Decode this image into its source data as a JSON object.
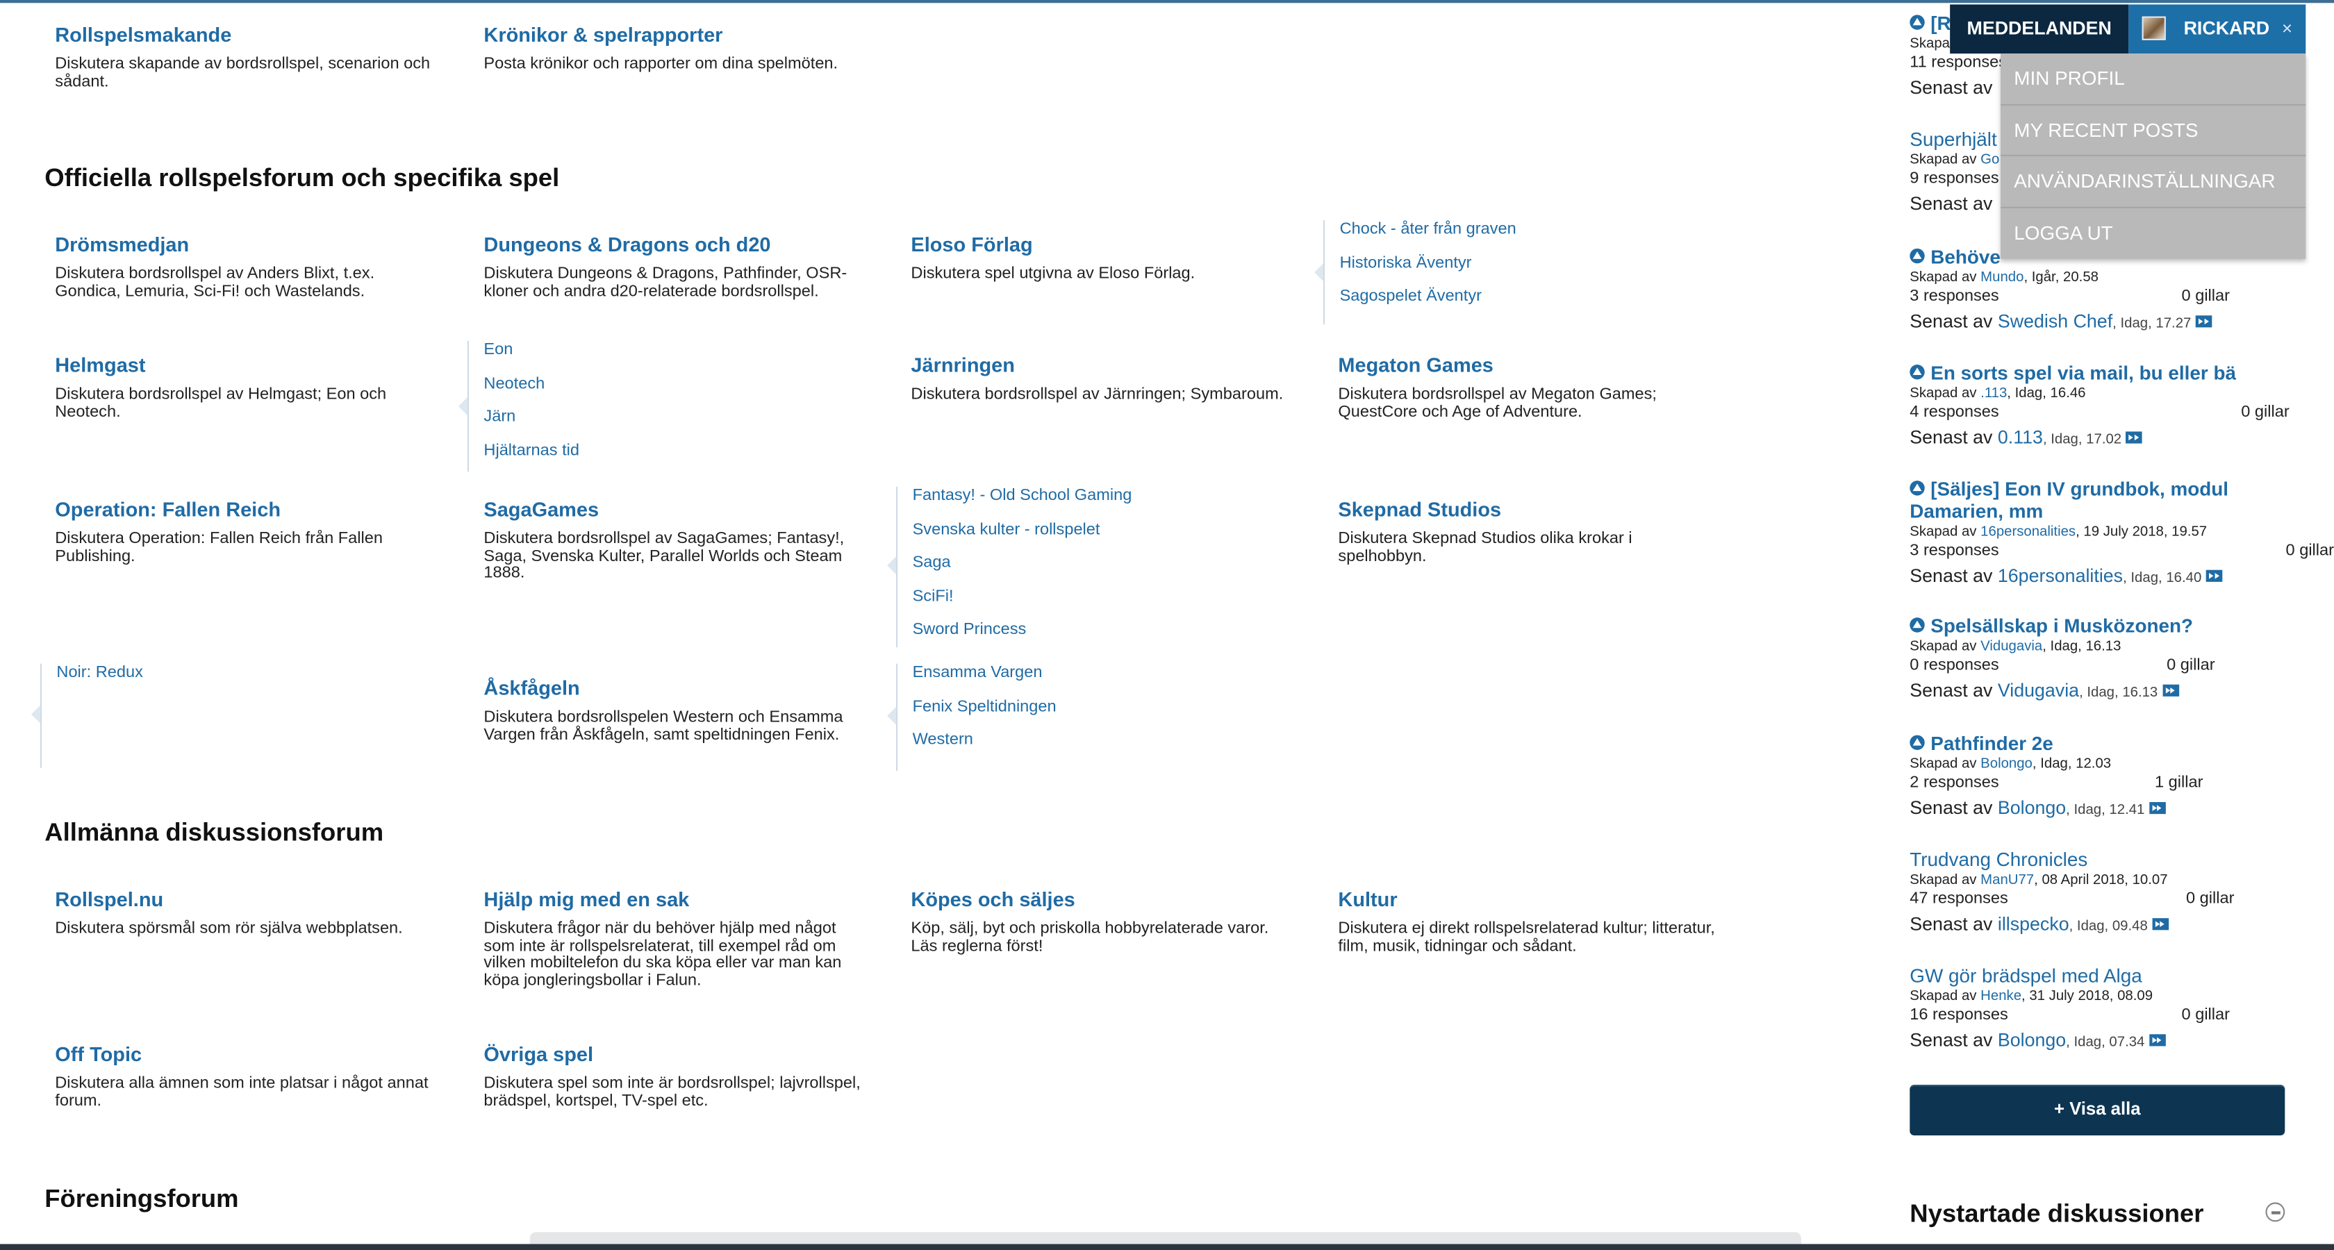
{
  "forum_sections": {
    "roleplay_cat": {
      "forums": [
        {
          "title": "Rollspelsmakande",
          "desc": "Diskutera skapande av bordsrollspel, scenarion och sådant."
        },
        {
          "title": "Krönikor & spelrapporter",
          "desc": "Posta krönikor och rapporter om dina spelmöten."
        }
      ]
    },
    "official": {
      "heading": "Officiella rollspelsforum och specifika spel",
      "forums": [
        {
          "title": "Drömsmedjan",
          "desc": "Diskutera bordsrollspel av Anders Blixt, t.ex. Gondica, Lemuria, Sci-Fi! och Wastelands."
        },
        {
          "title": "Dungeons & Dragons och d20",
          "desc": "Diskutera Dungeons & Dragons, Pathfinder, OSR-kloner och andra d20-relaterade bordsrollspel."
        },
        {
          "title": "Eloso Förlag",
          "desc": "Diskutera spel utgivna av Eloso Förlag."
        },
        {
          "title": "Helmgast",
          "desc": "Diskutera bordsrollspel av Helmgast; Eon och Neotech."
        },
        {
          "title": "Järnringen",
          "desc": "Diskutera bordsrollspel av Järnringen; Symbaroum."
        },
        {
          "title": "Megaton Games",
          "desc": "Diskutera bordsrollspel av Megaton Games; QuestCore och Age of Adventure."
        },
        {
          "title": "Operation: Fallen Reich",
          "desc": "Diskutera Operation: Fallen Reich från Fallen Publishing."
        },
        {
          "title": "SagaGames",
          "desc": "Diskutera bordsrollspel av SagaGames; Fantasy!, Saga, Svenska Kulter, Parallel Worlds och Steam 1888."
        },
        {
          "title": "Skepnad Studios",
          "desc": "Diskutera Skepnad Studios olika krokar i spelhobbyn."
        },
        {
          "title": "Åskfågeln",
          "desc": "Diskutera bordsrollspelen Western och Ensamma Vargen från Åskfågeln, samt speltidningen Fenix."
        }
      ],
      "subforums_eloso": [
        "Chock - åter från graven",
        "Historiska Äventyr",
        "Sagospelet Äventyr"
      ],
      "subforums_helmgast": [
        "Eon",
        "Neotech",
        "Järn",
        "Hjältarnas tid"
      ],
      "subforums_saga": [
        "Fantasy! - Old School Gaming",
        "Svenska kulter - rollspelet",
        "Saga",
        "SciFi!",
        "Sword Princess"
      ],
      "subforums_fallen": [
        "Noir: Redux"
      ],
      "subforums_askfageln": [
        "Ensamma Vargen",
        "Fenix Speltidningen",
        "Western"
      ]
    },
    "general": {
      "heading": "Allmänna diskussionsforum",
      "forums": [
        {
          "title": "Rollspel.nu",
          "desc": "Diskutera spörsmål som rör själva webbplatsen."
        },
        {
          "title": "Hjälp mig med en sak",
          "desc": "Diskutera frågor när du behöver hjälp med något som inte är rollspelsrelaterat, till exempel råd om vilken mobiltelefon du ska köpa eller var man kan köpa jongleringsbollar i Falun."
        },
        {
          "title": "Köpes och säljes",
          "desc": "Köp, sälj, byt och priskolla hobbyrelaterade varor. Läs reglerna först!"
        },
        {
          "title": "Kultur",
          "desc": "Diskutera ej direkt rollspelsrelaterad kultur; litteratur, film, musik, tidningar och sådant."
        },
        {
          "title": "Off Topic",
          "desc": "Diskutera alla ämnen som inte platsar i något annat forum."
        },
        {
          "title": "Övriga spel",
          "desc": "Diskutera spel som inte är bordsrollspel; lajvrollspel, brädspel, kortspel, TV-spel etc."
        }
      ]
    },
    "association": {
      "heading": "Föreningsforum"
    }
  },
  "sidebar": {
    "threads": [
      {
        "title": "[R",
        "created_prefix": "Skapa",
        "author": "",
        "date": "",
        "responses": "11 responses",
        "likes": "",
        "last_prefix": "Senast av",
        "last_user": "",
        "last_time": ""
      },
      {
        "title": "Superhjält",
        "created_prefix": "Skapad av",
        "author": "Go",
        "date": "",
        "responses": "9 responses",
        "likes": "",
        "last_prefix": "Senast av",
        "last_user": "",
        "last_time": ""
      },
      {
        "title": "Behöve",
        "created_prefix": "Skapad av",
        "author": "Mundo",
        "date": ", Igår, 20.58",
        "responses": "3 responses",
        "likes": "0 gillar",
        "last_prefix": "Senast av",
        "last_user": "Swedish Chef",
        "last_time": ", Idag, 17.27"
      },
      {
        "title": "En sorts spel via mail, bu eller bä",
        "created_prefix": "Skapad av",
        "author": ".113",
        "date": ", Idag, 16.46",
        "responses": "4 responses",
        "likes": "0 gillar",
        "last_prefix": "Senast av",
        "last_user": "0.113",
        "last_time": ", Idag, 17.02"
      },
      {
        "title": "[Säljes] Eon IV grundbok, modul Damarien, mm",
        "created_prefix": "Skapad av",
        "author": "16personalities",
        "date": ", 19 July 2018, 19.57",
        "responses": "3 responses",
        "likes": "0 gillar",
        "last_prefix": "Senast av",
        "last_user": "16personalities",
        "last_time": ", Idag, 16.40"
      },
      {
        "title": "Spelsällskap i Musközonen?",
        "created_prefix": "Skapad av",
        "author": "Vidugavia",
        "date": ", Idag, 16.13",
        "responses": "0 responses",
        "likes": "0 gillar",
        "last_prefix": "Senast av",
        "last_user": "Vidugavia",
        "last_time": ", Idag, 16.13"
      },
      {
        "title": "Pathfinder 2e",
        "created_prefix": "Skapad av",
        "author": "Bolongo",
        "date": ", Idag, 12.03",
        "responses": "2 responses",
        "likes": "1 gillar",
        "last_prefix": "Senast av",
        "last_user": "Bolongo",
        "last_time": ", Idag, 12.41"
      },
      {
        "title": "Trudvang Chronicles",
        "created_prefix": "Skapad av",
        "author": "ManU77",
        "date": ", 08 April 2018, 10.07",
        "responses": "47 responses",
        "likes": "0 gillar",
        "last_prefix": "Senast av",
        "last_user": "illspecko",
        "last_time": ", Idag, 09.48"
      },
      {
        "title": "GW gör brädspel med Alga",
        "created_prefix": "Skapad av",
        "author": "Henke",
        "date": ", 31 July 2018, 08.09",
        "responses": "16 responses",
        "likes": "0 gillar",
        "last_prefix": "Senast av",
        "last_user": "Bolongo",
        "last_time": ", Idag, 07.34"
      }
    ],
    "show_all": "+ Visa alla",
    "new_discussions_heading": "Nystartade diskussioner"
  },
  "topnav": {
    "notifications": "MEDDELANDEN",
    "username": "RICKARD",
    "close": "×"
  },
  "user_menu": {
    "items": [
      "MIN PROFIL",
      "MY RECENT POSTS",
      "ANVÄNDARINSTÄLLNINGAR",
      "LOGGA UT"
    ]
  },
  "icons": {
    "thread": "pin-icon",
    "jump": "jump-to-last-icon",
    "collapse": "collapse-icon",
    "avatar": "avatar"
  },
  "colors": {
    "link": "#1f6ba5",
    "nav_dark": "#0c2840",
    "nav_user": "#1d6fa8",
    "dropdown": "#b9b9b9",
    "button": "#0d3552"
  }
}
